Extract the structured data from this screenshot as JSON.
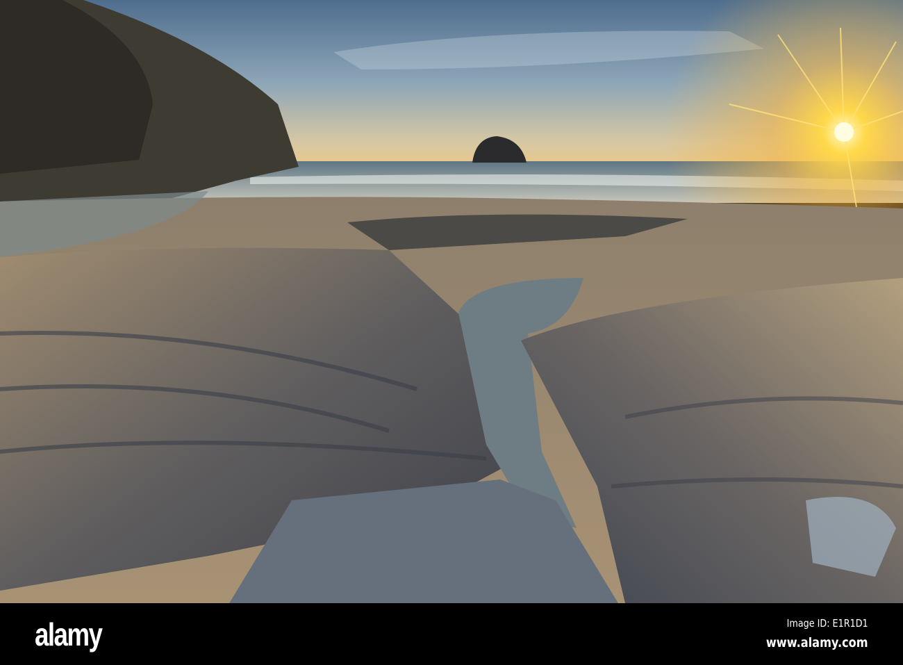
{
  "watermark": {
    "brand": "alamy",
    "image_id": "Image ID: E1R1D1",
    "url": "www.alamy.com"
  },
  "colors": {
    "sky_top": "#5d7a99",
    "horizon": "#f2c56a",
    "sun": "#fff4a0",
    "rock": "#6b6258",
    "sea": "#9fb0b8"
  }
}
